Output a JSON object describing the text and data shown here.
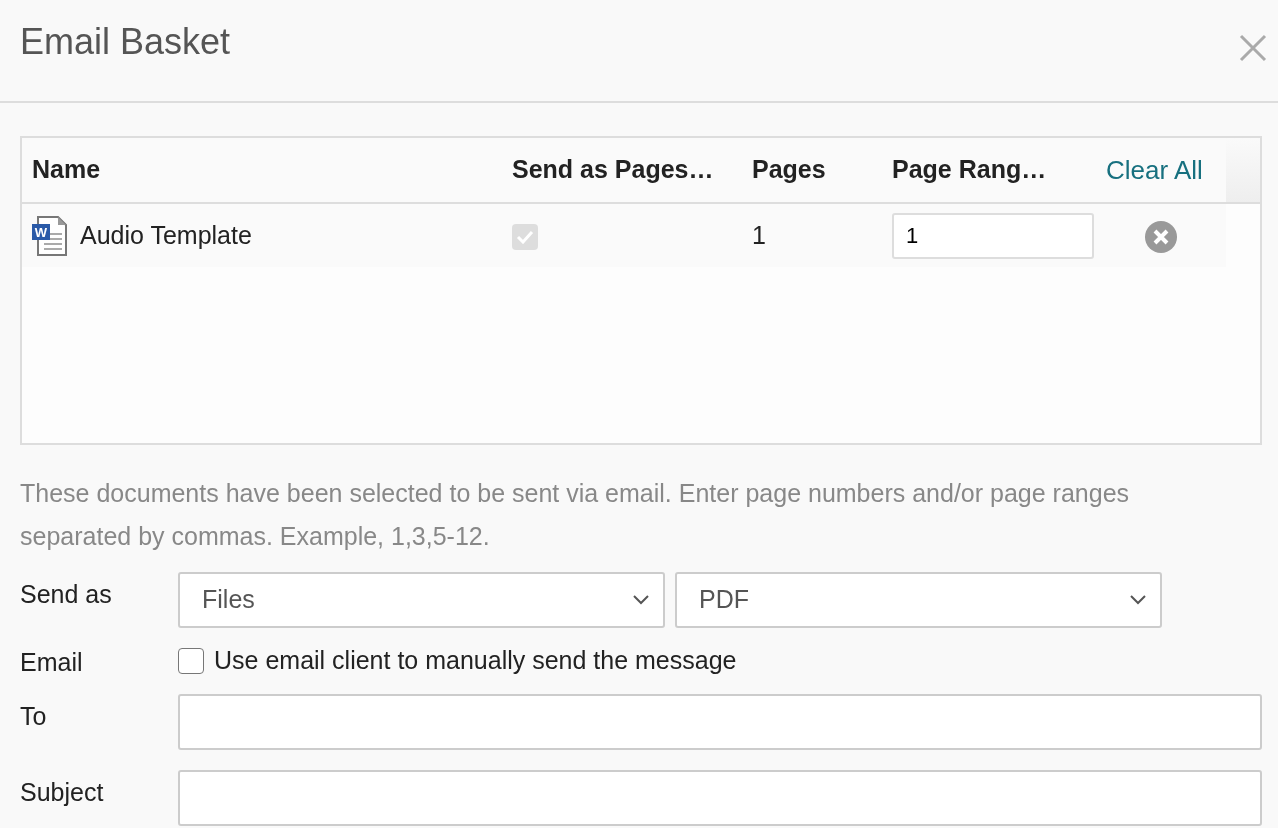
{
  "dialog": {
    "title": "Email Basket"
  },
  "table": {
    "columns": [
      "Name",
      "Send as Pages…",
      "Pages",
      "Page Rang…"
    ],
    "clear_all": "Clear All",
    "rows": [
      {
        "icon_letter": "W",
        "name": "Audio Template",
        "send_as_pages": {
          "checked": true,
          "disabled": true
        },
        "pages": "1",
        "page_range": "1"
      }
    ]
  },
  "description": "These documents have been selected to be sent via email. Enter page numbers and/or page ranges separated by commas. Example, 1,3,5-12.",
  "form": {
    "send_as": {
      "label": "Send as",
      "format": "Files",
      "file_type": "PDF"
    },
    "email": {
      "label": "Email",
      "option": "Use email client to manually send the message",
      "checked": false
    },
    "to": {
      "label": "To"
    },
    "subject": {
      "label": "Subject"
    }
  }
}
